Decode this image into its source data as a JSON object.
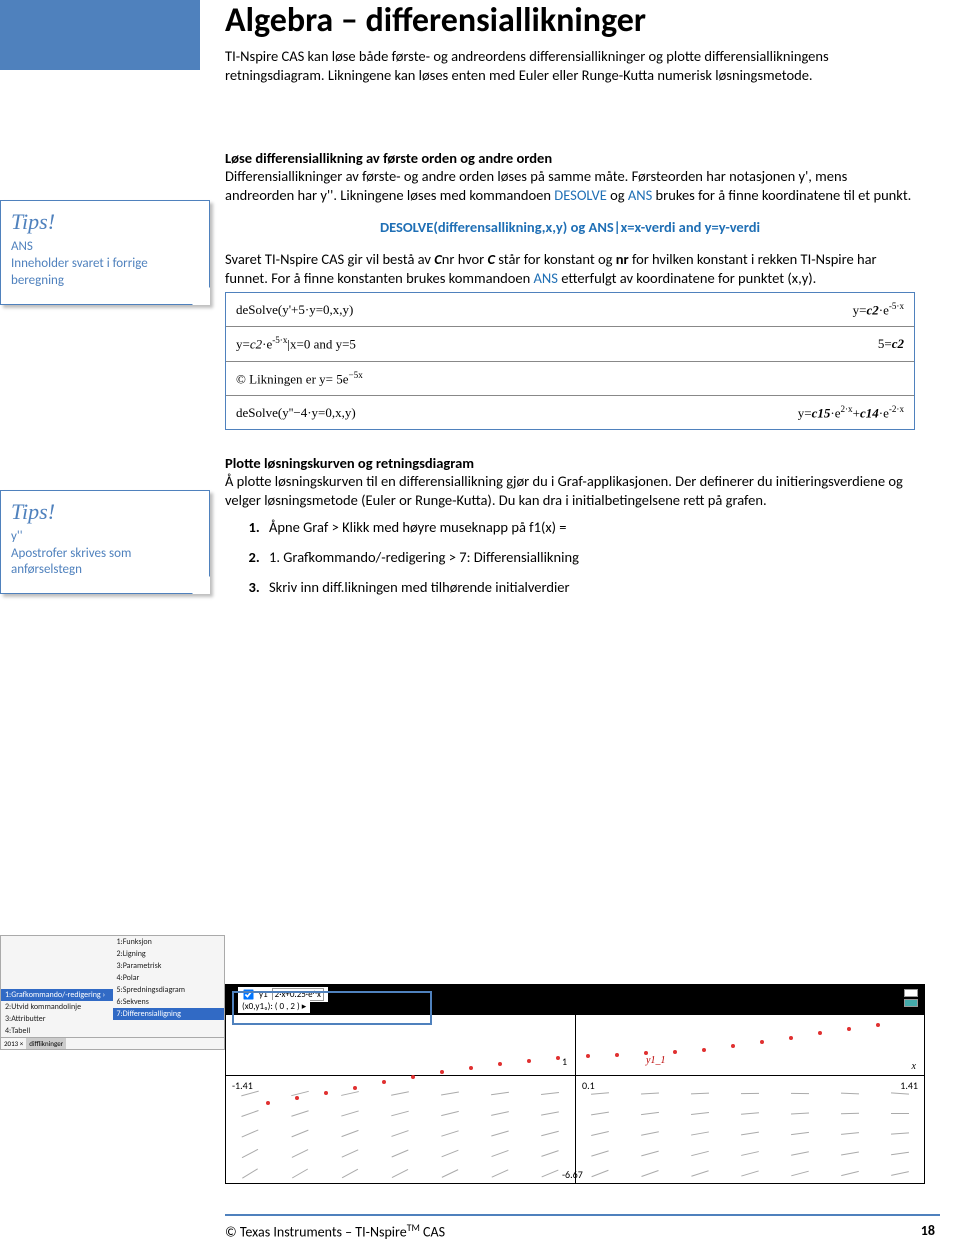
{
  "page": {
    "title": "Algebra – differensiallikninger",
    "intro1": "TI-Nspire CAS kan løse både første- og andreordens differensiallikninger og plotte differensiallikningens retningsdiagram. Likningene kan løses enten med Euler eller Runge-Kutta numerisk løsningsmetode.",
    "sec1_head": "Løse differensiallikning av første orden og andre orden",
    "sec1_body": "Differensiallikninger av første- og andre orden løses på samme måte. Førsteorden har notasjonen y', mens andreorden har y''. Likningene løses med kommandoen ",
    "sec1_cmd1": "DESOLVE",
    "sec1_body2": " og ",
    "sec1_cmd2": "ANS",
    "sec1_body3": " brukes for å finne koordinatene til et punkt.",
    "center": "DESOLVE(differensallikning,x,y) og ANS|x=x-verdi and y=y-verdi",
    "sec2a": "Svaret TI-Nspire CAS gir vil bestå av ",
    "sec2b": "C",
    "sec2c": "nr hvor ",
    "sec2d": "C",
    "sec2e": " står for konstant og ",
    "sec2f": "nr",
    "sec2g": " for hvilken konstant i rekken TI-Nspire har funnet. For å finne konstanten brukes kommandoen ",
    "sec2h": "ANS",
    "sec2i": " etterfulgt av koordinatene for punktet (x,y).",
    "sec3_head": "Plotte løsningskurven og retningsdiagram",
    "sec3_body": "Å plotte løsningskurven til en differensiallikning gjør du i Graf-applikasjonen. Der definerer du initieringsverdiene og velger løsningsmetode (Euler or Runge-Kutta). Du kan dra i initialbetingelsene rett på grafen.",
    "steps": [
      "Åpne Graf > Klikk med høyre museknapp på f1(x) =",
      "1. Grafkommando/-redigering > 7: Differensiallikning",
      "Skriv inn diff.likningen med tilhørende initialverdier"
    ]
  },
  "tips": [
    {
      "title": "Tips!",
      "line1": "ANS",
      "line2": "Inneholder svaret i forrige beregning"
    },
    {
      "title": "Tips!",
      "line1": "y''",
      "line2": "Apostrofer skrives som anførselstegn"
    }
  ],
  "cas": {
    "r1_left": "deSolve(y'+5·y=0,x,y)",
    "r1_right_a": "y=",
    "r1_right_b": "c2",
    "r1_right_c": "·e",
    "r1_right_d": "-5·x",
    "r2_left_a": "y=",
    "r2_left_b": "c2",
    "r2_left_c": "·e",
    "r2_left_d": "-5·x",
    "r2_left_e": "|x=0 and y=5",
    "r2_right_a": "5=",
    "r2_right_b": "c2",
    "r3_left": "© Likningen er y= 5e",
    "r3_left_sup": "−5x",
    "r4_left": "deSolve(y''−4·y=0,x,y)",
    "r4_right_a": "y=",
    "r4_right_b": "c15",
    "r4_right_c": "·e",
    "r4_right_d": "2·x",
    "r4_right_e": "+",
    "r4_right_f": "c14",
    "r4_right_g": "·e",
    "r4_right_h": "-2·x"
  },
  "menu": {
    "left": [
      "1:Grafkommando/-redigering ›",
      "2:Utvid kommandolinje",
      "3:Attributter",
      "4:Tabell"
    ],
    "left_sub": [
      "2013  ×",
      "difflikninger"
    ],
    "right": [
      "1:Funksjon",
      "2:Ligning",
      "3:Parametrisk",
      "4:Polar",
      "5:Spredningsdiagram",
      "6:Sekvens",
      "7:Differensialligning"
    ]
  },
  "graph": {
    "eq1_label": "y1",
    "eq1_expr": "2·x+0.25·e^x",
    "eq2_label": "(x0,y1₀):",
    "eq2_vals": "( 0     , 2     )",
    "y_curve_label": "y1_1",
    "x_var": "x",
    "ticks": {
      "left": "-1.41",
      "center": "0.1",
      "right": "1.41",
      "bottom": "-6.67",
      "top": "1"
    }
  },
  "footer": {
    "copy": "© Texas Instruments – TI-Nspire",
    "tm": "TM",
    "prod": " CAS",
    "page": "18"
  }
}
